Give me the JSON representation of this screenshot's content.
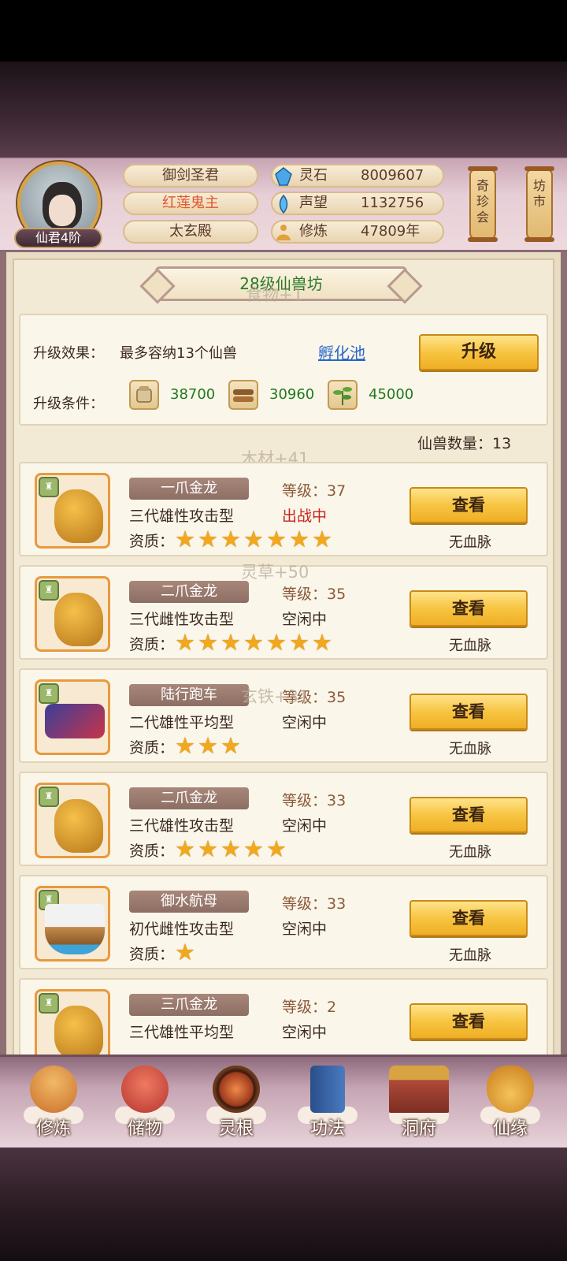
{
  "header": {
    "rank": "仙君4阶",
    "titles": [
      "御剑圣君",
      "红莲鬼主",
      "太玄殿"
    ],
    "resources": [
      {
        "icon": "spirit-stone-icon",
        "label": "灵石",
        "value": "8009607"
      },
      {
        "icon": "reputation-icon",
        "label": "声望",
        "value": "1132756"
      },
      {
        "icon": "cultivation-icon",
        "label": "修炼",
        "value": "47809年"
      }
    ],
    "scrolls": [
      "奇珍会",
      "坊市"
    ]
  },
  "main": {
    "banner": "28级仙兽坊",
    "effect_label": "升级效果：",
    "effect_text": "最多容纳13个仙兽",
    "effect_link": "孵化池",
    "upgrade_button": "升级",
    "condition_label": "升级条件：",
    "materials": [
      {
        "icon": "food-icon",
        "value": "38700"
      },
      {
        "icon": "wood-icon",
        "value": "30960"
      },
      {
        "icon": "herb-icon",
        "value": "45000"
      }
    ],
    "count_text": "仙兽数量：13",
    "ghost_texts": [
      "食物+1",
      "木材+41",
      "灵草+50",
      "玄铁+31"
    ]
  },
  "pets": [
    {
      "name": "一爪金龙",
      "gen": "三代雄性攻击型",
      "level": "等级：37",
      "status": "出战中",
      "stars": "★★★★★★★",
      "view": "查看",
      "bloodline": "无血脉",
      "art": "dragon-icon"
    },
    {
      "name": "二爪金龙",
      "gen": "三代雌性攻击型",
      "level": "等级：35",
      "status": "空闲中",
      "stars": "★★★★★★★",
      "view": "查看",
      "bloodline": "无血脉",
      "art": "dragon-icon"
    },
    {
      "name": "陆行跑车",
      "gen": "二代雄性平均型",
      "level": "等级：35",
      "status": "空闲中",
      "stars": "★★★",
      "view": "查看",
      "bloodline": "无血脉",
      "art": "race-car-icon"
    },
    {
      "name": "二爪金龙",
      "gen": "三代雄性攻击型",
      "level": "等级：33",
      "status": "空闲中",
      "stars": "★★★★★",
      "view": "查看",
      "bloodline": "无血脉",
      "art": "dragon-icon"
    },
    {
      "name": "御水航母",
      "gen": "初代雌性攻击型",
      "level": "等级：33",
      "status": "空闲中",
      "stars": "★",
      "view": "查看",
      "bloodline": "无血脉",
      "art": "ship-icon"
    },
    {
      "name": "三爪金龙",
      "gen": "三代雄性平均型",
      "level": "等级：2",
      "status": "空闲中",
      "stars": "",
      "view": "查看",
      "bloodline": "",
      "art": "dragon-icon"
    }
  ],
  "quality_label": "资质：",
  "nav": [
    {
      "label": "修炼",
      "icon": "cultivate-icon",
      "color": "#d98a3a"
    },
    {
      "label": "储物",
      "icon": "storage-bag-icon",
      "color": "#d14a4a"
    },
    {
      "label": "灵根",
      "icon": "spirit-root-icon",
      "color": "#b5552a"
    },
    {
      "label": "功法",
      "icon": "technique-book-icon",
      "color": "#3a6fb0"
    },
    {
      "label": "洞府",
      "icon": "cave-mansion-icon",
      "color": "#b04a3a"
    },
    {
      "label": "仙缘",
      "icon": "fortune-gourd-icon",
      "color": "#e0a13a"
    }
  ],
  "colors": {
    "accent_gold": "#f7c542",
    "status_red": "#c8241c",
    "value_green": "#1f7a1f",
    "link_blue": "#2a66c9"
  }
}
